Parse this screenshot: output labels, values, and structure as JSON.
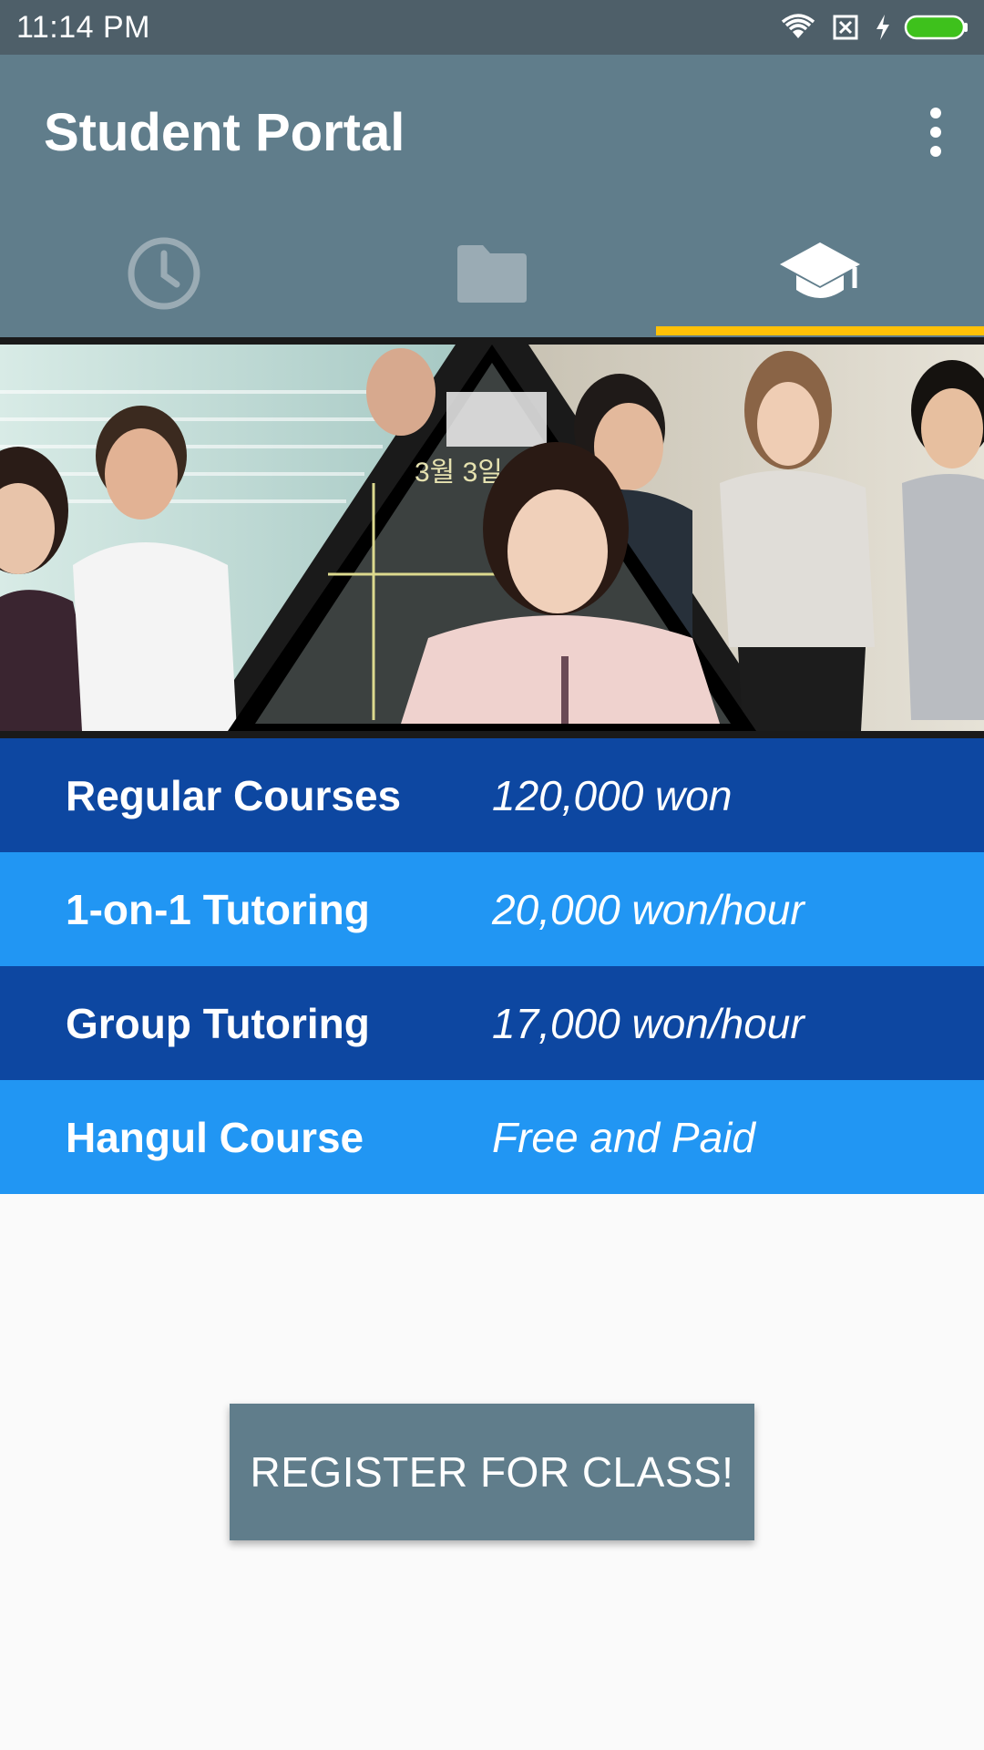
{
  "status_bar": {
    "time": "11:14 PM",
    "icons": [
      "wifi-icon",
      "no-sim-icon",
      "charging-icon",
      "battery-icon"
    ],
    "battery_color": "#3ec11c"
  },
  "app_bar": {
    "title": "Student Portal",
    "menu_icon": "more-vert-icon",
    "color": "#607d8b"
  },
  "tabs": [
    {
      "icon": "clock-icon",
      "active": false
    },
    {
      "icon": "folder-icon",
      "active": false
    },
    {
      "icon": "graduation-cap-icon",
      "active": true
    }
  ],
  "tab_indicator_color": "#ffc107",
  "banner": {
    "handwriting": "3월 3일"
  },
  "courses": [
    {
      "name": "Regular Courses",
      "price": "120,000 won"
    },
    {
      "name": "1-on-1 Tutoring",
      "price": "20,000 won/hour"
    },
    {
      "name": "Group Tutoring",
      "price": "17,000 won/hour"
    },
    {
      "name": "Hangul Course",
      "price": "Free and Paid"
    }
  ],
  "row_colors": {
    "dark": "#0d47a1",
    "light": "#2196f3"
  },
  "register_button": {
    "label": "REGISTER FOR CLASS!"
  }
}
